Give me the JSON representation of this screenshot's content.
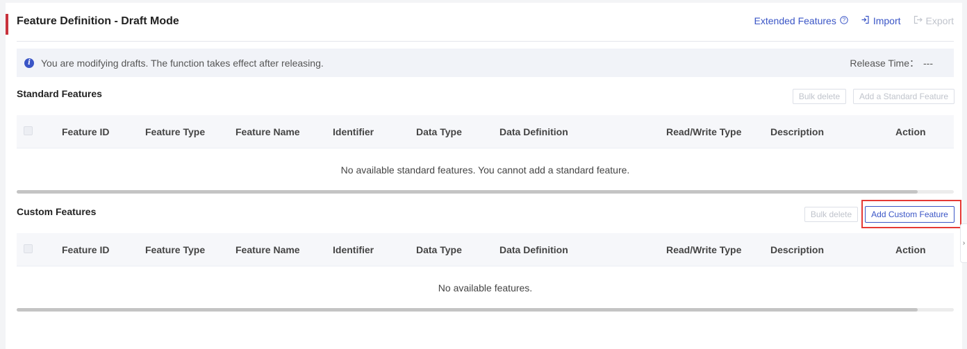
{
  "header": {
    "title": "Feature Definition - Draft Mode",
    "extended_features": "Extended Features",
    "import_label": "Import",
    "export_label": "Export"
  },
  "info": {
    "message": "You are modifying drafts. The function takes effect after releasing.",
    "release_label": "Release Time：",
    "release_value": "---"
  },
  "standard": {
    "title": "Standard Features",
    "bulk_delete": "Bulk delete",
    "add_button": "Add a Standard Feature",
    "empty_text": "No available standard features. You cannot add a standard feature."
  },
  "custom": {
    "title": "Custom Features",
    "bulk_delete": "Bulk delete",
    "add_button": "Add Custom Feature",
    "empty_text": "No available features."
  },
  "columns": {
    "feature_id": "Feature ID",
    "feature_type": "Feature Type",
    "feature_name": "Feature Name",
    "identifier": "Identifier",
    "data_type": "Data Type",
    "data_definition": "Data Definition",
    "read_write_type": "Read/Write Type",
    "description": "Description",
    "action": "Action"
  },
  "colors": {
    "accent": "#3a55c6",
    "title_bar": "#c8323c",
    "highlight": "#e53935"
  },
  "icons": {
    "extended_help": "question-circle-icon",
    "import": "import-icon",
    "export": "export-icon",
    "info": "info-icon",
    "side_tab": "chevron-right-icon"
  }
}
